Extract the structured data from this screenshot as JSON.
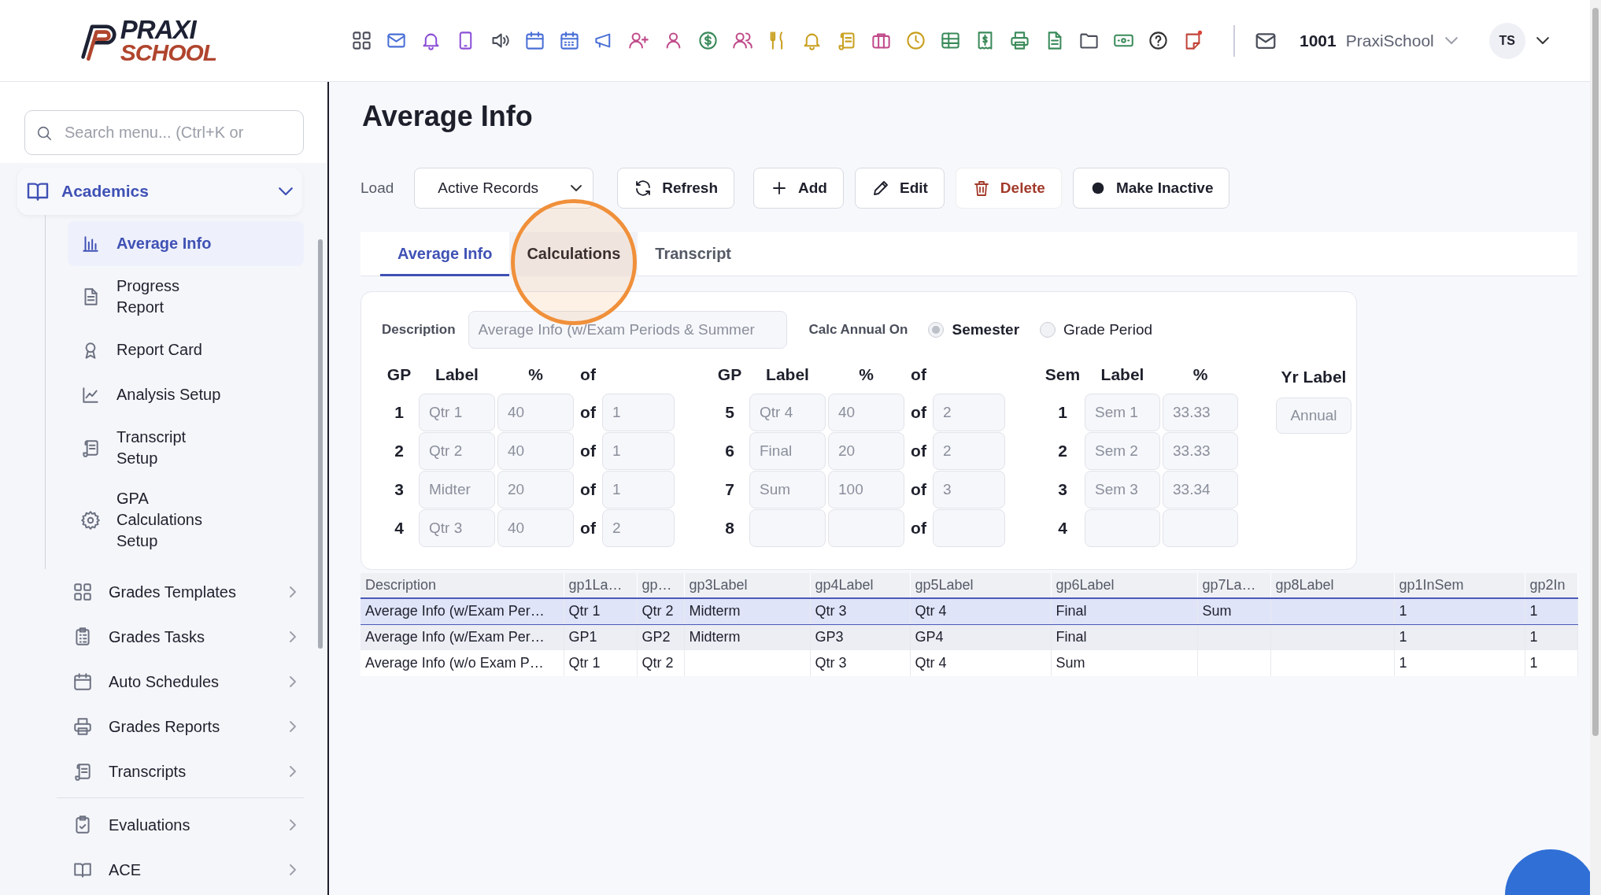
{
  "logo": {
    "top": "PRAXI",
    "bottom": "SCHOOL"
  },
  "header": {
    "school_id": "1001",
    "school_name": "PraxiSchool",
    "avatar": "TS"
  },
  "sidebar": {
    "search": {
      "placeholder": "Search menu... (Ctrl+K or"
    },
    "sections": [
      {
        "items": [
          {
            "label": "Academics",
            "expanded": true,
            "children": [
              {
                "label": "Average Info",
                "selected": true
              },
              {
                "label": "Progress Report",
                "selected": false
              },
              {
                "label": "Report Card",
                "selected": false
              },
              {
                "label": "Analysis Setup",
                "selected": false
              },
              {
                "label": "Transcript Setup",
                "selected": false
              },
              {
                "label": "GPA Calculations Setup",
                "selected": false
              }
            ]
          },
          {
            "label": "Grades Templates",
            "expanded": false
          },
          {
            "label": "Grades Tasks",
            "expanded": false
          },
          {
            "label": "Auto Schedules",
            "expanded": false
          },
          {
            "label": "Grades Reports",
            "expanded": false
          },
          {
            "label": "Transcripts",
            "expanded": false
          }
        ]
      },
      {
        "items": [
          {
            "label": "Evaluations",
            "expanded": false
          },
          {
            "label": "ACE",
            "expanded": false
          }
        ]
      }
    ]
  },
  "page": {
    "title": "Average Info",
    "toolbar": {
      "load_label": "Load",
      "load_value": "Active Records",
      "buttons": [
        {
          "label": "Refresh",
          "kind": "refresh"
        },
        {
          "label": "Add",
          "kind": "add"
        },
        {
          "label": "Edit",
          "kind": "edit"
        },
        {
          "label": "Delete",
          "kind": "delete"
        },
        {
          "label": "Make Inactive",
          "kind": "inactive"
        }
      ]
    },
    "tabs": [
      {
        "label": "Average Info",
        "selected": true,
        "highlighted": false
      },
      {
        "label": "Calculations",
        "selected": false,
        "highlighted": true
      },
      {
        "label": "Transcript",
        "selected": false,
        "highlighted": false
      }
    ],
    "form": {
      "description": {
        "label": "Description",
        "value": "Average Info (w/Exam Periods & Summer"
      },
      "calc_annual_on": {
        "label": "Calc Annual On",
        "options": [
          {
            "label": "Semester",
            "selected": true
          },
          {
            "label": "Grade Period",
            "selected": false
          }
        ]
      },
      "grade_periods": [
        {
          "headers": [
            "GP",
            "Label",
            "%",
            "of"
          ],
          "rows": [
            {
              "num": "1",
              "label": "Qtr 1",
              "percent": "40",
              "of_word": "of",
              "of": "1"
            },
            {
              "num": "2",
              "label": "Qtr 2",
              "percent": "40",
              "of_word": "of",
              "of": "1"
            },
            {
              "num": "3",
              "label": "Midter",
              "percent": "20",
              "of_word": "of",
              "of": "1"
            },
            {
              "num": "4",
              "label": "Qtr 3",
              "percent": "40",
              "of_word": "of",
              "of": "2"
            }
          ]
        },
        {
          "headers": [
            "GP",
            "Label",
            "%",
            "of"
          ],
          "rows": [
            {
              "num": "5",
              "label": "Qtr 4",
              "percent": "40",
              "of_word": "of",
              "of": "2"
            },
            {
              "num": "6",
              "label": "Final",
              "percent": "20",
              "of_word": "of",
              "of": "2"
            },
            {
              "num": "7",
              "label": "Sum",
              "percent": "100",
              "of_word": "of",
              "of": "3"
            },
            {
              "num": "8",
              "of_word": "of"
            }
          ]
        }
      ],
      "semesters": {
        "headers": [
          "Sem",
          "Label",
          "%"
        ],
        "rows": [
          {
            "num": "1",
            "label": "Sem 1",
            "percent": "33.33"
          },
          {
            "num": "2",
            "label": "Sem 2",
            "percent": "33.33"
          },
          {
            "num": "3",
            "label": "Sem 3",
            "percent": "33.34"
          },
          {
            "num": "4"
          }
        ]
      },
      "year": {
        "header": "Yr Label",
        "label": "Annual"
      }
    },
    "table": {
      "columns": [
        "Description",
        "gp1La…",
        "gp…",
        "gp3Label",
        "gp4Label",
        "gp5Label",
        "gp6Label",
        "gp7La…",
        "gp8Label",
        "gp1InSem",
        "gp2In"
      ],
      "rows": [
        {
          "selected": true,
          "cells": [
            "Average Info (w/Exam Per…",
            "Qtr 1",
            "Qtr 2",
            "Midterm",
            "Qtr 3",
            "Qtr 4",
            "Final",
            "Sum",
            "",
            "1",
            "1"
          ]
        },
        {
          "selected": false,
          "cells": [
            "Average Info (w/Exam Per…",
            "GP1",
            "GP2",
            "Midterm",
            "GP3",
            "GP4",
            "Final",
            "",
            "",
            "1",
            "1"
          ]
        },
        {
          "selected": false,
          "cells": [
            "Average Info (w/o Exam P…",
            "Qtr 1",
            "Qtr 2",
            "",
            "Qtr 3",
            "Qtr 4",
            "Sum",
            "",
            "",
            "1",
            "1"
          ]
        }
      ]
    }
  }
}
